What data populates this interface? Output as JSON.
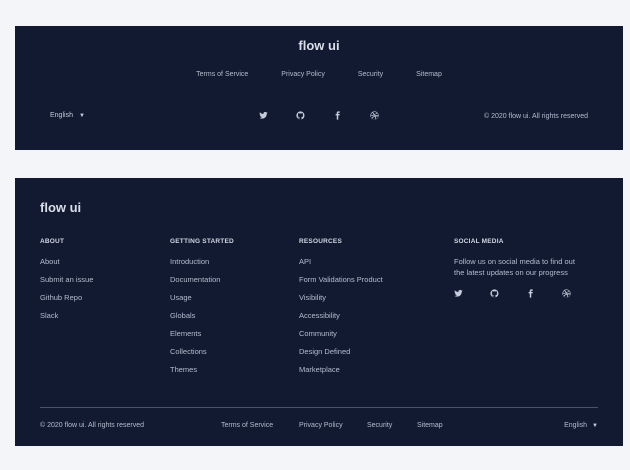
{
  "footer1": {
    "brand": "flow ui",
    "links": [
      "Terms of Service",
      "Privacy Policy",
      "Security",
      "Sitemap"
    ],
    "language": "English",
    "copyright": "© 2020 flow ui. All rights reserved",
    "social_icons": [
      "twitter-icon",
      "github-icon",
      "facebook-icon",
      "dribbble-icon"
    ]
  },
  "footer2": {
    "brand": "flow ui",
    "columns": [
      {
        "heading": "ABOUT",
        "links": [
          "About",
          "Submit an issue",
          "Github Repo",
          "Slack"
        ]
      },
      {
        "heading": "GETTING STARTED",
        "links": [
          "Introduction",
          "Documentation",
          "Usage",
          "Globals",
          "Elements",
          "Collections",
          "Themes"
        ]
      },
      {
        "heading": "RESOURCES",
        "links": [
          "API",
          "Form Validations Product",
          "Visibility",
          "Accessibility",
          "Community",
          "Design Defined",
          "Marketplace"
        ]
      }
    ],
    "social": {
      "heading": "SOCIAL MEDIA",
      "text": "Follow us on social media to find out the latest updates on our progress",
      "icons": [
        "twitter-icon",
        "github-icon",
        "facebook-icon",
        "dribbble-icon"
      ]
    },
    "copyright": "© 2020 flow ui. All rights reserved",
    "links": [
      "Terms of Service",
      "Privacy Policy",
      "Security",
      "Sitemap"
    ],
    "language": "English"
  }
}
